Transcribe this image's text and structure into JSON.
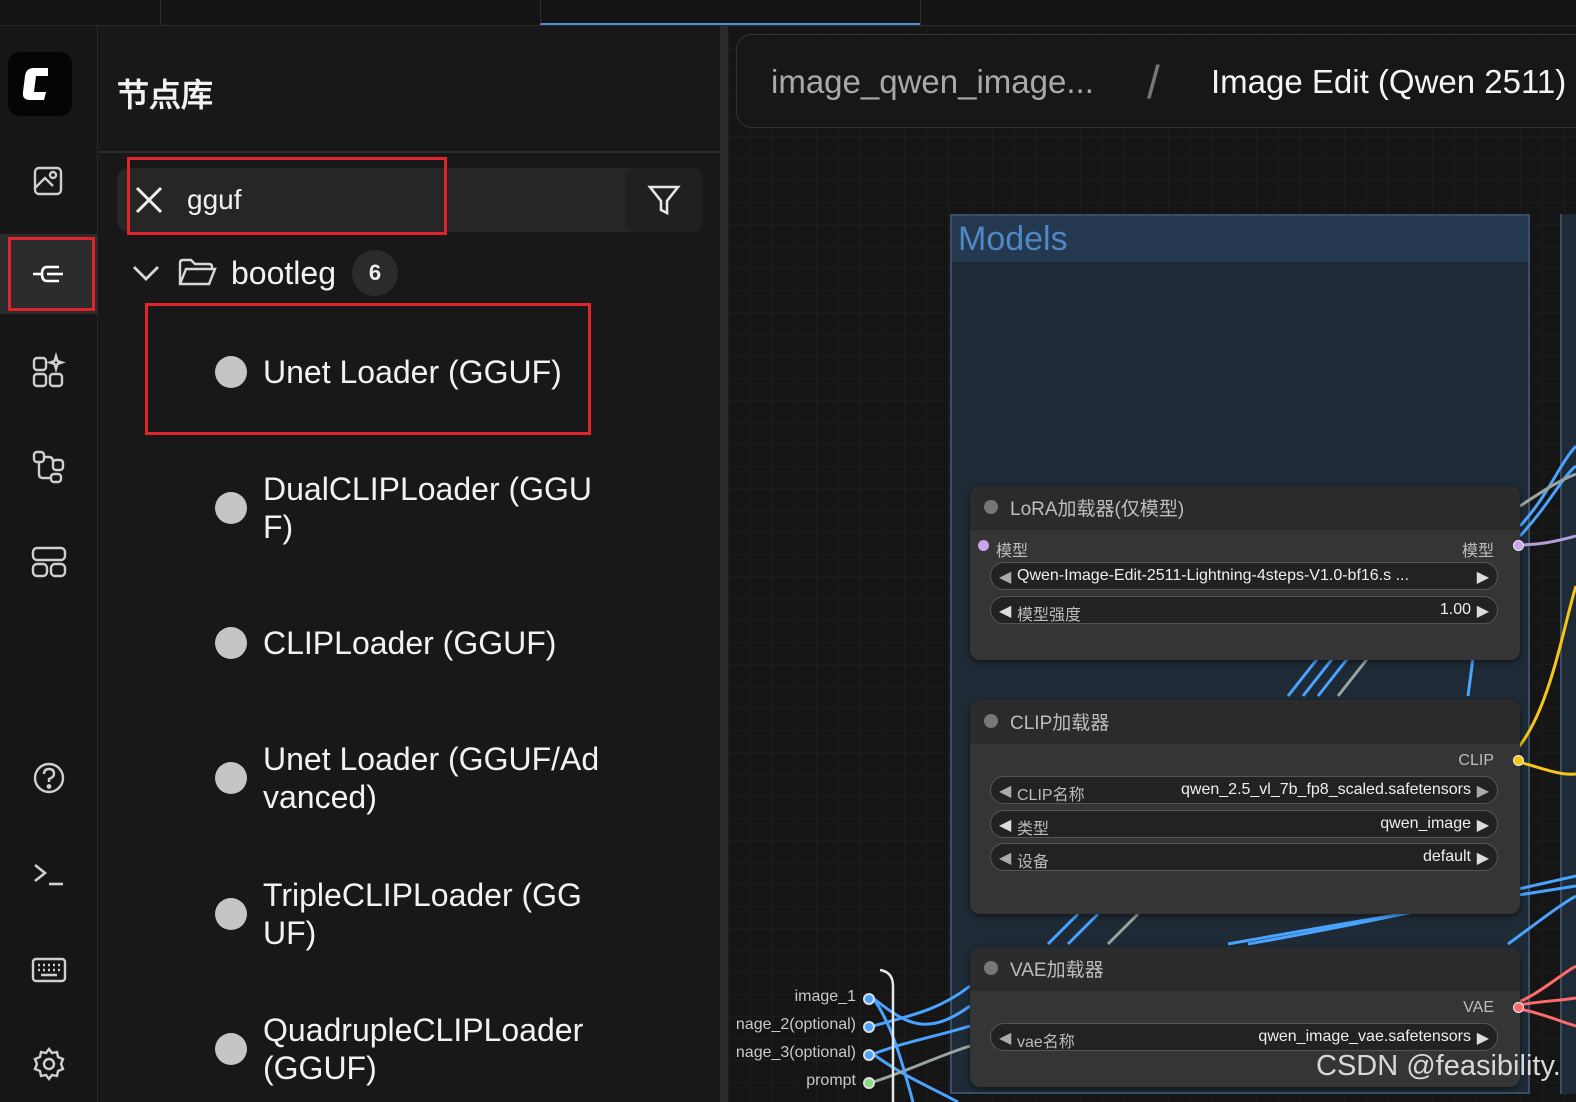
{
  "panel": {
    "title": "节点库",
    "search_value": "gguf",
    "folder": {
      "label": "bootleg",
      "count": "6"
    },
    "items": [
      {
        "label": "Unet Loader (GGUF)"
      },
      {
        "label": "DualCLIPLoader (GGUF)"
      },
      {
        "label": "CLIPLoader (GGUF)"
      },
      {
        "label": "Unet Loader (GGUF/Advanced)"
      },
      {
        "label": "TripleCLIPLoader (GGUF)"
      },
      {
        "label": "QuadrupleCLIPLoader (GGUF)"
      }
    ]
  },
  "breadcrumb": {
    "workflow": "image_qwen_image...",
    "separator": "/",
    "subgraph": "Image Edit (Qwen 2511)"
  },
  "group": {
    "title": "Models"
  },
  "nodes": {
    "lora": {
      "title": "LoRA加载器(仅模型)",
      "input": "模型",
      "output": "模型",
      "lora_name": "Qwen-Image-Edit-2511-Lightning-4steps-V1.0-bf16.s ...",
      "strength_label": "模型强度",
      "strength_value": "1.00"
    },
    "clip": {
      "title": "CLIP加载器",
      "output": "CLIP",
      "name_label": "CLIP名称",
      "name_value": "qwen_2.5_vl_7b_fp8_scaled.safetensors",
      "type_label": "类型",
      "type_value": "qwen_image",
      "device_label": "设备",
      "device_value": "default"
    },
    "vae": {
      "title": "VAE加载器",
      "output": "VAE",
      "name_label": "vae名称",
      "name_value": "qwen_image_vae.safetensors"
    }
  },
  "subgraph_inputs": [
    "image_1",
    "nage_2(optional)",
    "nage_3(optional)",
    "prompt"
  ],
  "watermark": "CSDN @feasibility.",
  "colors": {
    "accent": "#4d8fd8",
    "highlight_box": "#e0242a",
    "wire_blue": "#4aa3ff",
    "wire_yellow": "#f5c518",
    "wire_red": "#ff6b6b",
    "wire_purple": "#b39ddb",
    "wire_green": "#7ee07e"
  },
  "icons": [
    "close-icon",
    "filter-icon",
    "chevron-down-icon",
    "folder-icon",
    "images-icon",
    "node-library-icon",
    "model-library-icon",
    "workflows-icon",
    "templates-icon",
    "help-icon",
    "console-icon",
    "keyboard-icon",
    "settings-icon"
  ]
}
